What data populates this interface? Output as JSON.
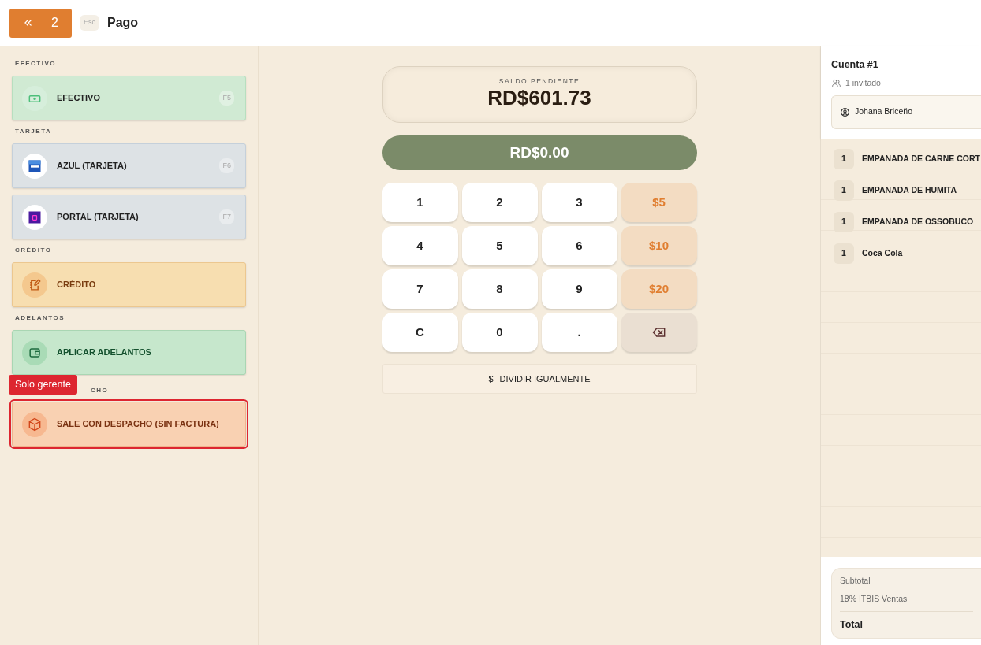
{
  "header": {
    "back_count": "2",
    "esc_key": "Esc",
    "title": "Pago"
  },
  "sections": [
    {
      "title": "EFECTIVO",
      "methods": [
        {
          "label": "EFECTIVO",
          "shortcut": "F5",
          "kind": "cash",
          "restricted": false
        }
      ]
    },
    {
      "title": "TARJETA",
      "methods": [
        {
          "label": "AZUL (TARJETA)",
          "shortcut": "F6",
          "kind": "azul",
          "restricted": false
        },
        {
          "label": "PORTAL (TARJETA)",
          "shortcut": "F7",
          "kind": "portal",
          "restricted": false
        }
      ]
    },
    {
      "title": "CRÉDITO",
      "methods": [
        {
          "label": "CRÉDITO",
          "kind": "credit",
          "restricted": false
        }
      ]
    },
    {
      "title": "ADELANTOS",
      "methods": [
        {
          "label": "APLICAR ADELANTOS",
          "kind": "advance",
          "restricted": false
        }
      ]
    },
    {
      "title": "CHO",
      "tooltip": "Solo gerente",
      "methods": [
        {
          "label": "SALE CON DESPACHO (SIN FACTURA)",
          "kind": "dispatch",
          "restricted": true
        }
      ]
    }
  ],
  "balance": {
    "label": "SALDO PENDIENTE",
    "amount": "RD$601.73"
  },
  "entered": "RD$0.00",
  "keypad": [
    {
      "label": "1",
      "kind": "digit"
    },
    {
      "label": "2",
      "kind": "digit"
    },
    {
      "label": "3",
      "kind": "digit"
    },
    {
      "label": "$5",
      "kind": "bill"
    },
    {
      "label": "4",
      "kind": "digit"
    },
    {
      "label": "5",
      "kind": "digit"
    },
    {
      "label": "6",
      "kind": "digit"
    },
    {
      "label": "$10",
      "kind": "bill"
    },
    {
      "label": "7",
      "kind": "digit"
    },
    {
      "label": "8",
      "kind": "digit"
    },
    {
      "label": "9",
      "kind": "digit"
    },
    {
      "label": "$20",
      "kind": "bill"
    },
    {
      "label": "C",
      "kind": "digit"
    },
    {
      "label": "0",
      "kind": "digit"
    },
    {
      "label": ".",
      "kind": "digit"
    },
    {
      "kind": "backspace"
    }
  ],
  "split_button": {
    "icon": "$",
    "label": "DIVIDIR IGUALMENTE"
  },
  "account": {
    "title": "Cuenta #1",
    "guests": "1 invitado",
    "customer": "Johana Briceño",
    "items": [
      {
        "qty": "1",
        "name": "EMPANADA DE CARNE CORT"
      },
      {
        "qty": "1",
        "name": "EMPANADA DE HUMITA"
      },
      {
        "qty": "1",
        "name": "EMPANADA DE OSSOBUCO"
      },
      {
        "qty": "1",
        "name": "Coca Cola"
      }
    ],
    "totals": [
      {
        "label": "Subtotal",
        "kind": "line"
      },
      {
        "label": "18% ITBIS Ventas",
        "kind": "line"
      },
      {
        "label": "Total",
        "kind": "total"
      }
    ]
  }
}
